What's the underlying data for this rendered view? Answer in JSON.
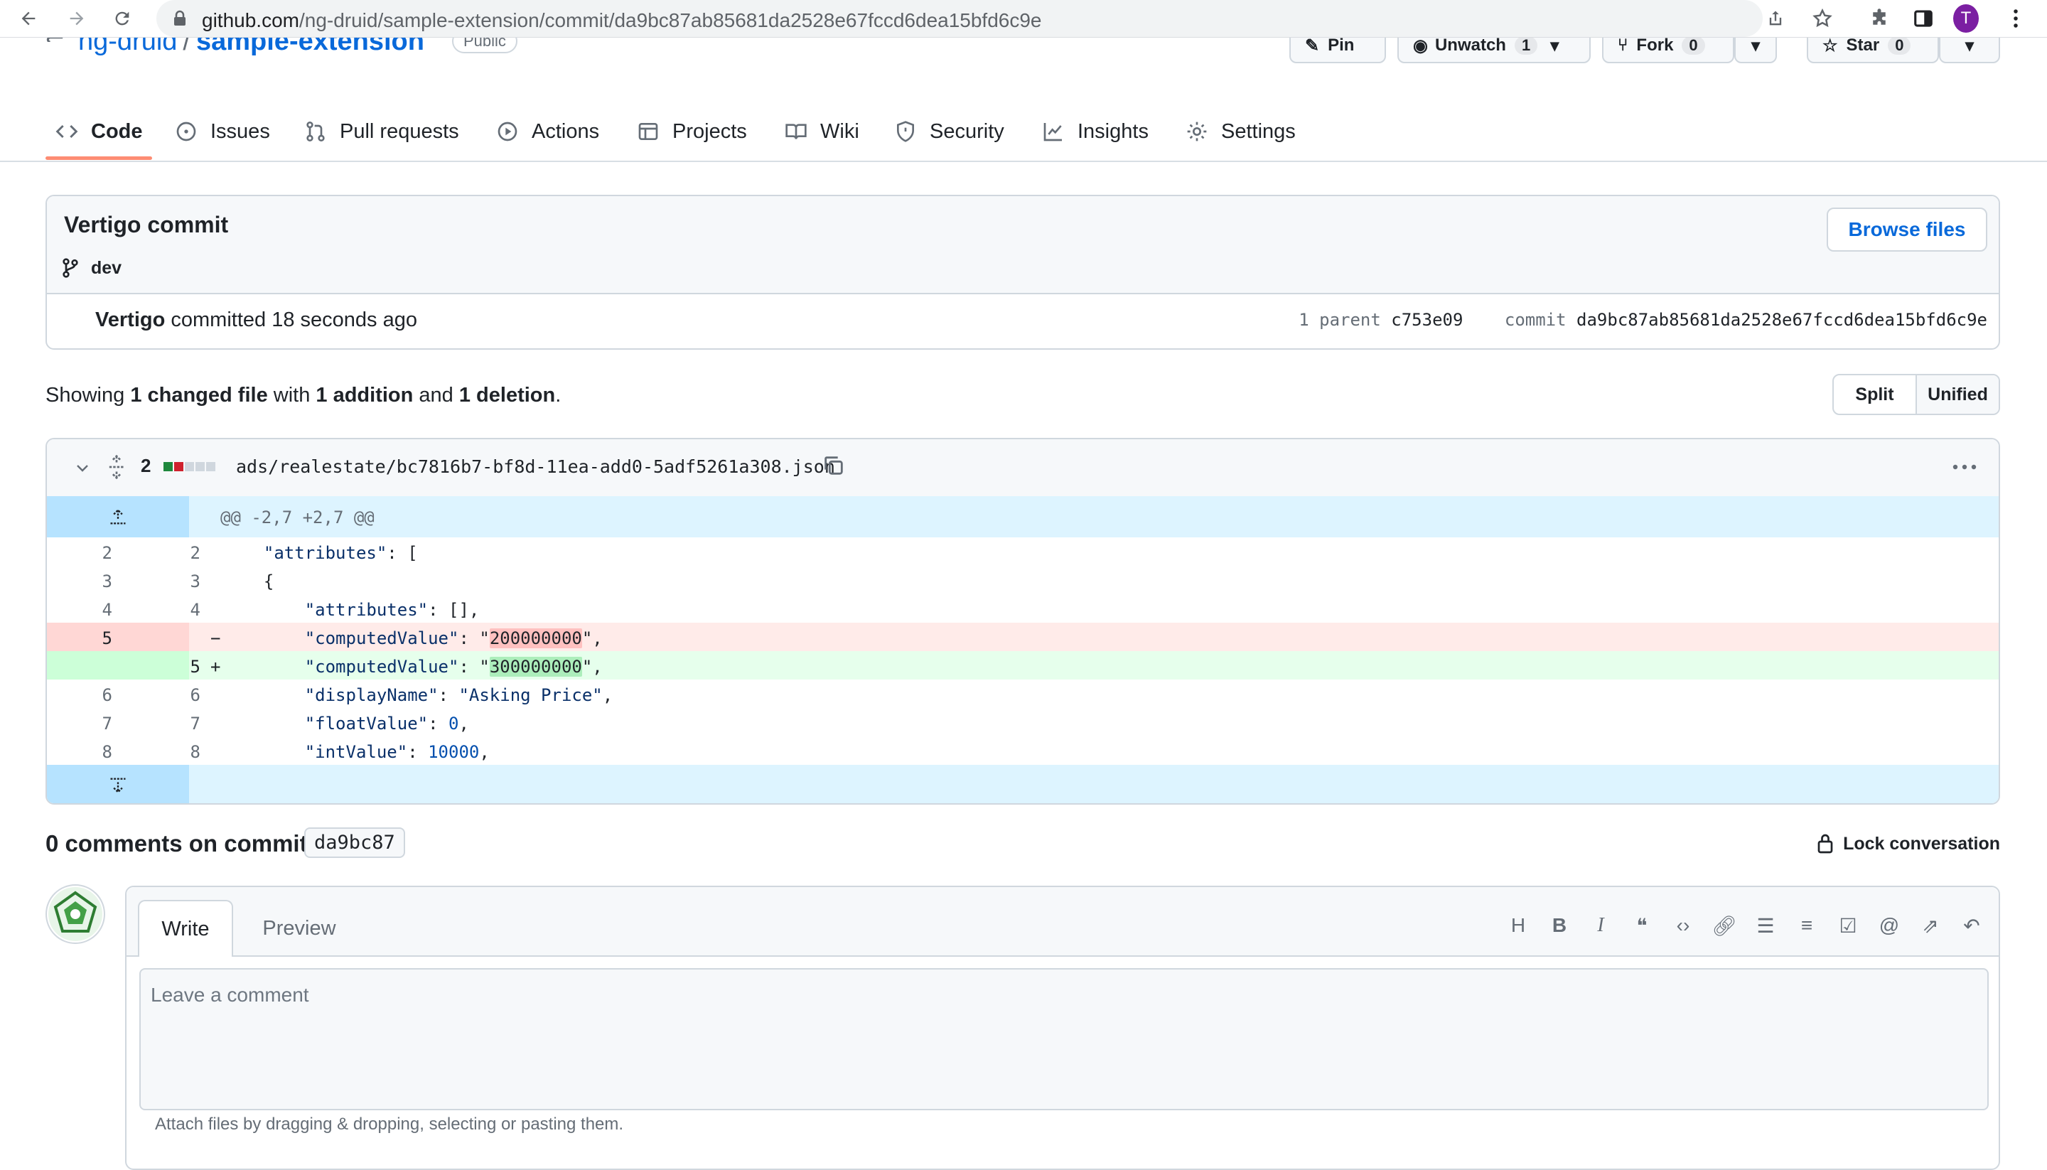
{
  "browser": {
    "url_host": "github.com",
    "url_path": "/ng-druid/sample-extension/commit/da9bc87ab85681da2528e67fccd6dea15bfd6c9e",
    "profile_initial": "T"
  },
  "repo": {
    "owner": "ng-druid",
    "separator": "/",
    "name": "sample-extension",
    "visibility": "Public",
    "pin_label": "Pin",
    "unwatch_label": "Unwatch",
    "unwatch_count": "1",
    "fork_label": "Fork",
    "fork_count": "0",
    "star_label": "Star",
    "star_count": "0"
  },
  "nav": {
    "tabs": [
      {
        "label": "Code"
      },
      {
        "label": "Issues"
      },
      {
        "label": "Pull requests"
      },
      {
        "label": "Actions"
      },
      {
        "label": "Projects"
      },
      {
        "label": "Wiki"
      },
      {
        "label": "Security"
      },
      {
        "label": "Insights"
      },
      {
        "label": "Settings"
      }
    ]
  },
  "commit": {
    "title": "Vertigo commit",
    "branch": "dev",
    "browse_label": "Browse files",
    "author": "Vertigo",
    "committed_text": "committed 18 seconds ago",
    "parent_label": "1 parent",
    "parent_sha": "c753e09",
    "commit_label": "commit",
    "sha": "da9bc87ab85681da2528e67fccd6dea15bfd6c9e"
  },
  "summary": {
    "prefix": "Showing",
    "changed": "1 changed file",
    "with": "with",
    "additions": "1 addition",
    "and": "and",
    "deletions": "1 deletion",
    "end": ".",
    "split_label": "Split",
    "unified_label": "Unified"
  },
  "diff": {
    "change_count": "2",
    "filename": "ads/realestate/bc7816b7-bf8d-11ea-add0-5adf5261a308.json",
    "hunk_header": "@@ -2,7 +2,7 @@",
    "lines": {
      "l2": {
        "old": "2",
        "new": "2",
        "key": "\"attributes\"",
        "rest": ": ["
      },
      "l3": {
        "old": "3",
        "new": "3",
        "text": "  {"
      },
      "l4": {
        "old": "4",
        "new": "4",
        "key": "\"attributes\"",
        "rest": ": [],"
      },
      "del": {
        "old": "5",
        "sign": "−",
        "key": "\"computedValue\"",
        "mid": ": \"",
        "hl": "200000000",
        "end": "\","
      },
      "add": {
        "new": "5",
        "sign": "+",
        "key": "\"computedValue\"",
        "mid": ": \"",
        "hl": "300000000",
        "end": "\","
      },
      "l6": {
        "old": "6",
        "new": "6",
        "key": "\"displayName\"",
        "mid": ": ",
        "val": "\"Asking Price\"",
        "end": ","
      },
      "l7": {
        "old": "7",
        "new": "7",
        "key": "\"floatValue\"",
        "mid": ": ",
        "val": "0",
        "end": ","
      },
      "l8": {
        "old": "8",
        "new": "8",
        "key": "\"intValue\"",
        "mid": ": ",
        "val": "10000",
        "end": ","
      }
    }
  },
  "comments": {
    "title": "0 comments on commit",
    "sha_short": "da9bc87",
    "lock_label": "Lock conversation",
    "write_tab": "Write",
    "preview_tab": "Preview",
    "placeholder": "Leave a comment",
    "attach_hint": "Attach files by dragging & dropping, selecting or pasting them."
  }
}
